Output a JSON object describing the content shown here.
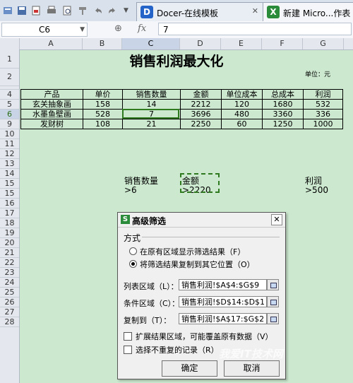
{
  "tabs": [
    {
      "label": "Docer-在线模板",
      "icon": "docer-icon",
      "color": "#2464c8"
    },
    {
      "label": "新建 Micro...作表",
      "icon": "excel-icon",
      "color": "#2a8c3a"
    }
  ],
  "formula_bar": {
    "cell_ref": "C6",
    "fx": "fx",
    "value": "7"
  },
  "columns": [
    "A",
    "B",
    "C",
    "D",
    "E",
    "F",
    "G"
  ],
  "rows": [
    "1",
    "2",
    "3",
    "4",
    "5",
    "6",
    "9",
    "10",
    "11",
    "12",
    "13",
    "14",
    "15",
    "15",
    "16",
    "17",
    "18",
    "19",
    "20",
    "21",
    "22",
    "23",
    "24",
    "25",
    "26",
    "27",
    "28"
  ],
  "sheet": {
    "title": "销售利润最大化",
    "unit": "单位：元",
    "headers": [
      "产品",
      "单价",
      "销售数量",
      "金额",
      "单位成本",
      "总成本",
      "利润"
    ],
    "data": [
      [
        "玄关抽象画",
        "158",
        "14",
        "2212",
        "120",
        "1680",
        "532"
      ],
      [
        "水墨鱼壁画",
        "528",
        "7",
        "3696",
        "480",
        "3360",
        "336"
      ],
      [
        "发财树",
        "108",
        "21",
        "2250",
        "60",
        "1250",
        "1000"
      ]
    ],
    "criteria": {
      "qty_label": "销售数量",
      "qty_value": ">6",
      "amount_label": "金额",
      "amount_value": ">2220",
      "profit_label": "利润",
      "profit_value": ">500"
    }
  },
  "dialog": {
    "title": "高级筛选",
    "mode_label": "方式",
    "option_in_place": "在原有区域显示筛选结果（F）",
    "option_copy": "将筛选结果复制到其它位置（O）",
    "list_range_label": "列表区域（L）：",
    "list_range_value": "销售利润!$A$4:$G$9",
    "criteria_range_label": "条件区域（C）：",
    "criteria_range_value": "销售利润!$D$14:$D$1",
    "copy_to_label": "复制到（T）：",
    "copy_to_value": "销售利润!$A$17:$G$2",
    "expand_label": "扩展结果区域，可能覆盖原有数据（V）",
    "unique_label": "选择不重复的记录（R）",
    "ok_label": "确定",
    "cancel_label": "取消"
  },
  "watermark": "我爱IT技术网"
}
